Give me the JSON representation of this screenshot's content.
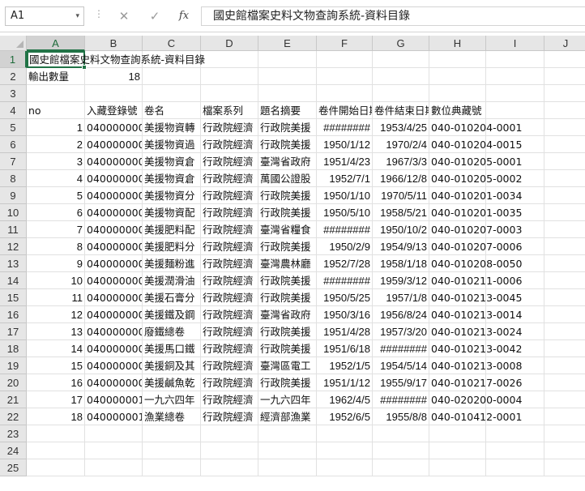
{
  "formula_bar": {
    "name_box": "A1",
    "dropdown_glyph": "▾",
    "separator": "⋮",
    "cancel_glyph": "✕",
    "enter_glyph": "✓",
    "fx_label": "fx",
    "content": "國史館檔案史料文物查詢系統-資料目錄"
  },
  "columns": [
    "A",
    "B",
    "C",
    "D",
    "E",
    "F",
    "G",
    "H",
    "I",
    "J"
  ],
  "selected_column": "A",
  "selected_row": "1",
  "row_numbers": [
    "1",
    "2",
    "3",
    "4",
    "5",
    "6",
    "7",
    "8",
    "9",
    "10",
    "11",
    "12",
    "13",
    "14",
    "15",
    "16",
    "17",
    "18",
    "19",
    "20",
    "21",
    "22",
    "23",
    "24",
    "25"
  ],
  "sheet": {
    "title": "國史館檔案史料文物查詢系統-資料目錄",
    "output_label": "輸出數量",
    "output_count": "18",
    "headers": [
      "no",
      "入藏登錄號",
      "卷名",
      "檔案系列",
      "題名摘要",
      "卷件開始日期",
      "卷件結束日期",
      "數位典藏號"
    ],
    "rows": [
      [
        "1",
        "040000000",
        "美援物資轉",
        "行政院經濟",
        "行政院美援",
        "########",
        "1953/4/25",
        "040-010204-0001"
      ],
      [
        "2",
        "040000000",
        "美援物資過",
        "行政院經濟",
        "行政院美援",
        "1950/1/12",
        "1970/2/4",
        "040-010204-0015"
      ],
      [
        "3",
        "040000000",
        "美援物資倉",
        "行政院經濟",
        "臺灣省政府",
        "1951/4/23",
        "1967/3/3",
        "040-010205-0001"
      ],
      [
        "4",
        "040000000",
        "美援物資倉",
        "行政院經濟",
        "萬國公證股",
        "1952/7/1",
        "1966/12/8",
        "040-010205-0002"
      ],
      [
        "5",
        "040000000",
        "美援物資分",
        "行政院經濟",
        "行政院美援",
        "1950/1/10",
        "1970/5/11",
        "040-010201-0034"
      ],
      [
        "6",
        "040000000",
        "美援物資配",
        "行政院經濟",
        "行政院美援",
        "1950/5/10",
        "1958/5/21",
        "040-010201-0035"
      ],
      [
        "7",
        "040000000",
        "美援肥料配",
        "行政院經濟",
        "臺灣省糧食",
        "########",
        "1950/10/2",
        "040-010207-0003"
      ],
      [
        "8",
        "040000000",
        "美援肥料分",
        "行政院經濟",
        "行政院美援",
        "1950/2/9",
        "1954/9/13",
        "040-010207-0006"
      ],
      [
        "9",
        "040000000",
        "美援麵粉進",
        "行政院經濟",
        "臺灣農林廳",
        "1952/7/28",
        "1958/1/18",
        "040-010208-0050"
      ],
      [
        "10",
        "040000000",
        "美援潤滑油",
        "行政院經濟",
        "行政院美援",
        "########",
        "1959/3/12",
        "040-010211-0006"
      ],
      [
        "11",
        "040000000",
        "美援石膏分",
        "行政院經濟",
        "行政院美援",
        "1950/5/25",
        "1957/1/8",
        "040-010213-0045"
      ],
      [
        "12",
        "040000000",
        "美援鐵及鋼",
        "行政院經濟",
        "臺灣省政府",
        "1950/3/16",
        "1956/8/24",
        "040-010213-0014"
      ],
      [
        "13",
        "040000000",
        "廢鐵總卷",
        "行政院經濟",
        "行政院美援",
        "1951/4/28",
        "1957/3/20",
        "040-010213-0024"
      ],
      [
        "14",
        "040000000",
        "美援馬口鐵",
        "行政院經濟",
        "行政院美援",
        "1951/6/18",
        "########",
        "040-010213-0042"
      ],
      [
        "15",
        "040000000",
        "美援銅及其",
        "行政院經濟",
        "臺灣區電工",
        "1952/1/5",
        "1954/5/14",
        "040-010213-0008"
      ],
      [
        "16",
        "040000000",
        "美援鹹魚乾",
        "行政院經濟",
        "行政院美援",
        "1951/1/12",
        "1955/9/17",
        "040-010217-0026"
      ],
      [
        "17",
        "040000001",
        "一九六四年",
        "行政院經濟",
        "一九六四年",
        "1962/4/5",
        "########",
        "040-020200-0004"
      ],
      [
        "18",
        "040000001",
        "漁業總卷",
        "行政院經濟",
        "經濟部漁業",
        "1952/6/5",
        "1955/8/8",
        "040-010412-0001"
      ]
    ]
  }
}
